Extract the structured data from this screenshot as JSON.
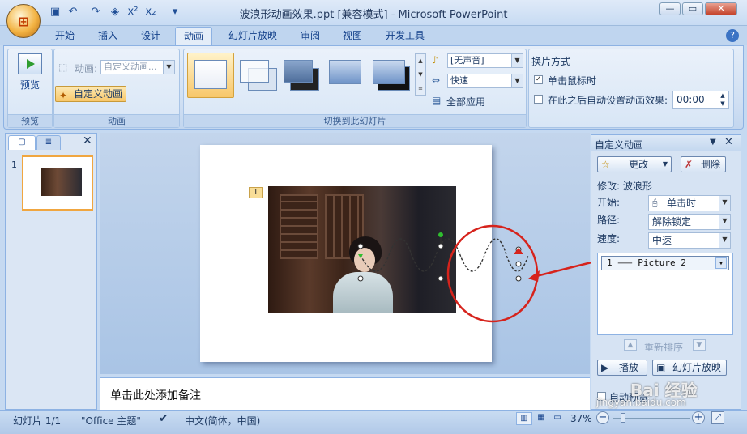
{
  "window": {
    "title": "波浪形动画效果.ppt [兼容模式] - Microsoft PowerPoint",
    "office_button_icon": "office-logo",
    "min_icon": "minimize-icon",
    "max_icon": "maximize-icon",
    "close_icon": "close-icon"
  },
  "tabs": [
    {
      "label": "开始"
    },
    {
      "label": "插入"
    },
    {
      "label": "设计"
    },
    {
      "label": "动画"
    },
    {
      "label": "幻灯片放映"
    },
    {
      "label": "审阅"
    },
    {
      "label": "视图"
    },
    {
      "label": "开发工具"
    }
  ],
  "ribbon": {
    "preview": {
      "button": "预览",
      "group": "预览"
    },
    "animation": {
      "anim_label": "动画:",
      "anim_value": "自定义动画...",
      "custom_button": "自定义动画",
      "group": "动画"
    },
    "transition": {
      "sound_value": "[无声音]",
      "speed_value": "快速",
      "apply_all": "全部应用",
      "group": "切换到此幻灯片"
    },
    "advance": {
      "header": "换片方式",
      "on_click": "单击鼠标时",
      "on_click_checked": true,
      "auto_after": "在此之后自动设置动画效果:",
      "auto_after_checked": false,
      "time_value": "00:00"
    }
  },
  "slide_pane": {
    "slide_number": "1"
  },
  "slide": {
    "anim_tag": "1"
  },
  "notes": {
    "placeholder": "单击此处添加备注"
  },
  "task_pane": {
    "title": "自定义动画",
    "change_button": "更改",
    "delete_button": "删除",
    "modify_label": "修改: 波浪形",
    "start_label": "开始:",
    "start_value": "单击时",
    "path_label": "路径:",
    "path_value": "解除锁定",
    "speed_label": "速度:",
    "speed_value": "中速",
    "list_item": "1  ⸺  Picture 2",
    "reorder_label": "重新排序",
    "play_button": "播放",
    "slideshow_button": "幻灯片放映",
    "autopreview_label": "自动预览",
    "autopreview_checked": false
  },
  "status_bar": {
    "slide_info": "幻灯片 1/1",
    "theme": "\"Office 主题\"",
    "language": "中文(简体，中国)",
    "zoom": "37%"
  },
  "watermark": {
    "brand": "Bai 经验",
    "url": "jingyan.baidu.com"
  },
  "colors": {
    "accent_red": "#d6231c",
    "active_orange": "#f8c76a",
    "ribbon_blue": "#c2d6ef"
  }
}
